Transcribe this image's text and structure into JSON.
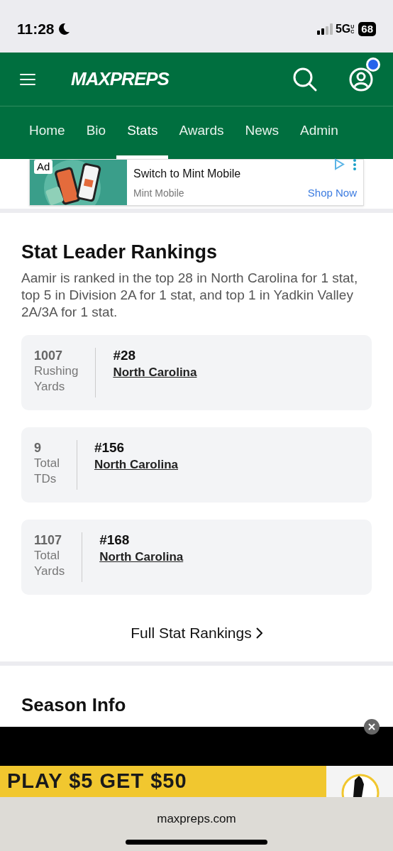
{
  "status_bar": {
    "time": "11:28",
    "network": "5G",
    "network_suffix": "UC",
    "battery": "68"
  },
  "header": {
    "logo": "MAXPREPS",
    "notification_dot": true
  },
  "tabs": [
    {
      "label": "Home",
      "selected": false
    },
    {
      "label": "Bio",
      "selected": false
    },
    {
      "label": "Stats",
      "selected": true
    },
    {
      "label": "Awards",
      "selected": false
    },
    {
      "label": "News",
      "selected": false
    },
    {
      "label": "Admin",
      "selected": false
    }
  ],
  "ad": {
    "badge": "Ad",
    "title": "Switch to Mint Mobile",
    "advertiser": "Mint Mobile",
    "cta": "Shop Now"
  },
  "stat_leader": {
    "title": "Stat Leader Rankings",
    "description": "Aamir is ranked in the top 28 in North Carolina for 1 stat, top 5 in Division 2A for 1 stat, and top 1 in Yadkin Valley 2A/3A for 1 stat.",
    "cards": [
      {
        "value": "1007",
        "label_lines": [
          "Rushing",
          "Yards"
        ],
        "rank": "#28",
        "region": "North Carolina"
      },
      {
        "value": "9",
        "label_lines": [
          "Total",
          "TDs"
        ],
        "rank": "#156",
        "region": "North Carolina"
      },
      {
        "value": "1107",
        "label_lines": [
          "Total",
          "Yards"
        ],
        "rank": "#168",
        "region": "North Carolina"
      }
    ],
    "link": "Full Stat Rankings"
  },
  "season_info": {
    "title": "Season Info"
  },
  "bottom_ad": {
    "text": "PLAY $5 GET $50"
  },
  "browser": {
    "url": "maxpreps.com"
  }
}
